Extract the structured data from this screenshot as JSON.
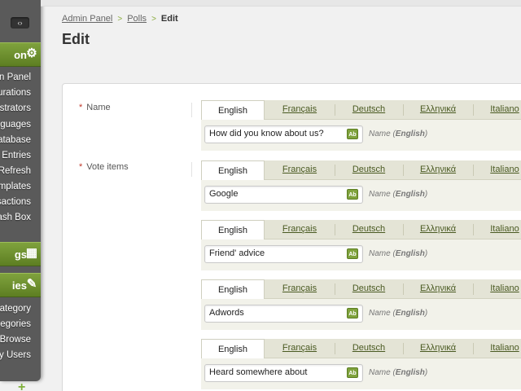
{
  "sidebar": {
    "toggle": "‹›",
    "section1": {
      "label": "on",
      "icon": "gear-icon"
    },
    "menu1": [
      "on Panel",
      "urations",
      "istrators",
      "nguages",
      "atabase",
      "Entries",
      "Refresh",
      "mplates",
      "sactions",
      "ash Box"
    ],
    "section2": {
      "label": "gs",
      "icon": "calculator-icon"
    },
    "section3": {
      "label": "ies",
      "icon": "pencil-icon"
    },
    "menu2": [
      "Category",
      "egories",
      "Browse",
      "y Users"
    ],
    "plus": "+"
  },
  "breadcrumb": {
    "items": [
      "Admin Panel",
      "Polls"
    ],
    "current": "Edit",
    "separator": ">"
  },
  "page_title": "Edit",
  "fields": {
    "name_label": "Name",
    "vote_label": "Vote items",
    "required_mark": "*"
  },
  "languages": [
    "English",
    "Français",
    "Deutsch",
    "Ελληνικά",
    "Italiano"
  ],
  "hint": {
    "prefix": "Name (",
    "lang": "English",
    "suffix": ")"
  },
  "ab_label": "Ab",
  "name_value": "How did you know about us?",
  "vote_items": [
    "Google",
    "Friend' advice",
    "Adwords",
    "Heard somewhere about"
  ]
}
